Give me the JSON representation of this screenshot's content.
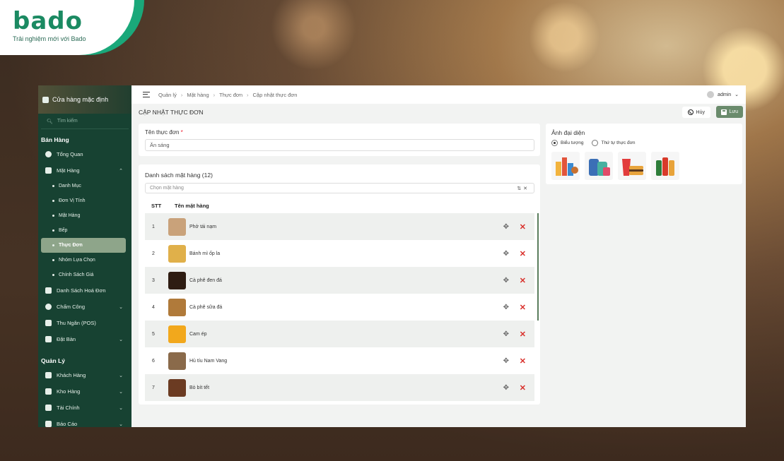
{
  "brand": {
    "logo": "bado",
    "tagline": "Trải nghiệm mới với Bado"
  },
  "sidebar": {
    "store": "Cửa hàng mặc định",
    "search_placeholder": "Tìm kiếm",
    "sections": [
      {
        "title": "Bán Hàng"
      },
      {
        "title": "Quản Lý"
      }
    ],
    "items": {
      "overview": "Tổng Quan",
      "products": "Mặt Hàng",
      "sub_category": "Danh Mục",
      "sub_unit": "Đơn Vị Tính",
      "sub_products": "Mặt Hàng",
      "sub_kitchen": "Bếp",
      "sub_menu": "Thực Đơn",
      "sub_options": "Nhóm Lựa Chọn",
      "sub_price": "Chính Sách Giá",
      "invoices": "Danh Sách Hoá Đơn",
      "timekeeping": "Chấm Công",
      "pos": "Thu Ngân (POS)",
      "booking": "Đặt Bàn",
      "customers": "Khách Hàng",
      "warehouse": "Kho Hàng",
      "finance": "Tài Chính",
      "reports": "Báo Cáo"
    }
  },
  "topbar": {
    "breadcrumb": [
      "Quản lý",
      "Mặt hàng",
      "Thực đơn",
      "Cập nhật thực đơn"
    ],
    "user": "admin"
  },
  "page": {
    "title": "CẬP NHẬT THỰC ĐƠN",
    "cancel": "Hủy",
    "save": "Lưu"
  },
  "form": {
    "name_label": "Tên thực đơn",
    "name_required": "*",
    "name_value": "Ăn sáng"
  },
  "list": {
    "title": "Danh sách mặt hàng (12)",
    "select_placeholder": "Chọn mặt hàng",
    "col_stt": "STT",
    "col_name": "Tên mặt hàng",
    "rows": [
      {
        "stt": "1",
        "name": "Phở tái nạm",
        "color": "#c9a27a"
      },
      {
        "stt": "2",
        "name": "Bánh mì ốp la",
        "color": "#e0b04a"
      },
      {
        "stt": "3",
        "name": "Cà phê đen đá",
        "color": "#2e1c12"
      },
      {
        "stt": "4",
        "name": "Cà phê sữa đá",
        "color": "#b07a3a"
      },
      {
        "stt": "5",
        "name": "Cam ép",
        "color": "#f2a81c"
      },
      {
        "stt": "6",
        "name": "Hủ tíu Nam Vang",
        "color": "#8a6a4a"
      },
      {
        "stt": "7",
        "name": "Bò bít tết",
        "color": "#6b3b22"
      }
    ]
  },
  "image_panel": {
    "title": "Ảnh đại diện",
    "opt_icon": "Biểu tượng",
    "opt_menu": "Thứ tự thực đơn"
  }
}
